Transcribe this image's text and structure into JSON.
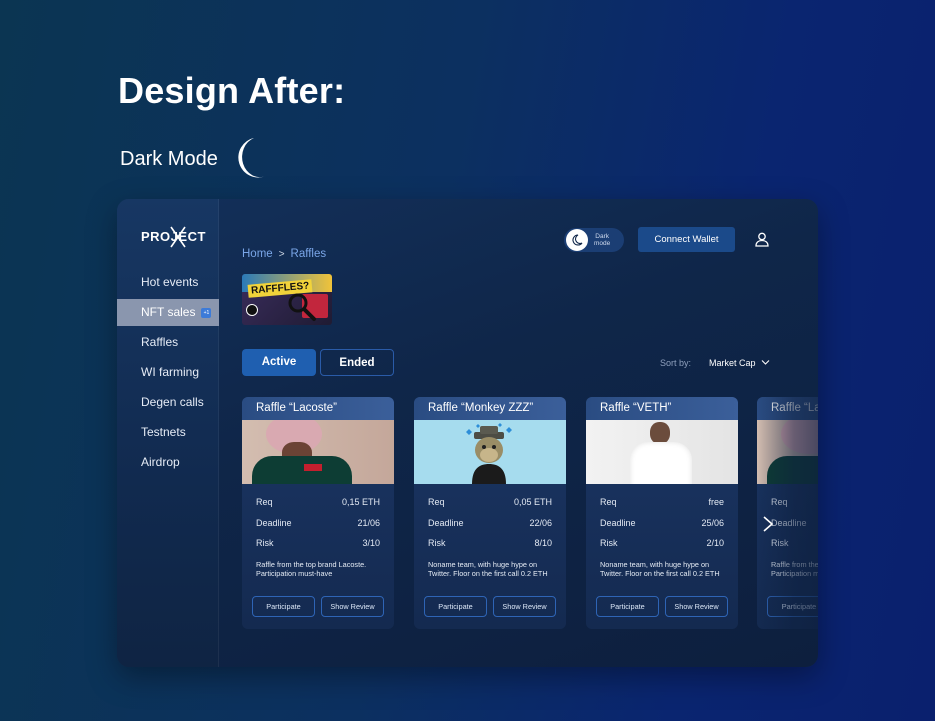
{
  "page": {
    "heading": "Design After:",
    "subheading": "Dark Mode"
  },
  "sidebar": {
    "logo": "PROJECT",
    "items": [
      {
        "label": "Hot events"
      },
      {
        "label": "NFT sales",
        "badge": "+1"
      },
      {
        "label": "Raffles"
      },
      {
        "label": "WI farming"
      },
      {
        "label": "Degen calls"
      },
      {
        "label": "Testnets"
      },
      {
        "label": "Airdrop"
      }
    ]
  },
  "breadcrumb": {
    "home": "Home",
    "sep": ">",
    "current": "Raffles"
  },
  "banner": {
    "text": "RAFFFLES?"
  },
  "header": {
    "toggle_label_1": "Dark",
    "toggle_label_2": "mode",
    "connect_label": "Connect Wallet"
  },
  "tabs": {
    "active": "Active",
    "ended": "Ended"
  },
  "sort": {
    "label": "Sort by:",
    "value": "Market Cap"
  },
  "labels": {
    "req": "Req",
    "deadline": "Deadline",
    "risk": "Risk",
    "participate": "Participate",
    "show_review": "Show Review"
  },
  "cards": [
    {
      "title": "Raffle “Lacoste”",
      "req": "0,15 ETH",
      "deadline": "21/06",
      "risk": "3/10",
      "desc": "Raffle from the top brand Lacoste. Participation must-have"
    },
    {
      "title": "Raffle “Monkey ZZZ”",
      "req": "0,05 ETH",
      "deadline": "22/06",
      "risk": "8/10",
      "desc": "Noname team, with huge hype on Twitter. Floor on the first call 0.2 ETH"
    },
    {
      "title": "Raffle “VETH”",
      "req": "free",
      "deadline": "25/06",
      "risk": "2/10",
      "desc": "Noname team, with huge hype on Twitter. Floor on the first call 0.2 ETH"
    },
    {
      "title": "Raffle “Lacoste”",
      "req": "",
      "deadline": "",
      "risk": "",
      "desc": "Raffle from the top brand Lacoste. Participation must-have"
    }
  ],
  "colors": {
    "accent": "#1f5fb0",
    "background": "#0c3060",
    "sidebar_active": "#8a96ae"
  }
}
